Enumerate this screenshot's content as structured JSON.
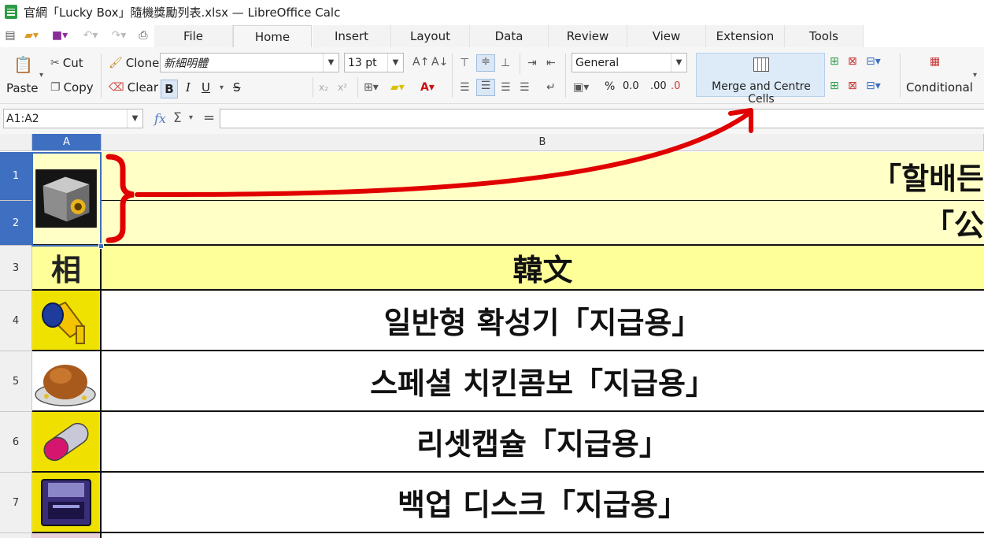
{
  "window": {
    "title": "官網「Lucky Box」隨機獎勵列表.xlsx — LibreOffice Calc"
  },
  "menu": {
    "tabs": [
      "File",
      "Home",
      "Insert",
      "Layout",
      "Data",
      "Review",
      "View",
      "Extension",
      "Tools"
    ],
    "active_tab": "Home"
  },
  "ribbon": {
    "paste": "Paste",
    "cut": "Cut",
    "copy": "Copy",
    "clone": "Clone",
    "clear": "Clear",
    "font_name": "新細明體",
    "font_size": "13 pt",
    "bold": "B",
    "italic": "I",
    "underline": "U",
    "strike": "S",
    "number_format": "General",
    "merge_label": "Merge and Centre Cells",
    "conditional": "Conditional",
    "percent": "%",
    "decimal": "0.0",
    "add_decimal": ".00",
    "remove_decimal": ".0"
  },
  "formula_bar": {
    "cell_ref": "A1:A2",
    "fx": "fx",
    "sigma": "Σ",
    "equals": "=",
    "content": ""
  },
  "grid": {
    "columns": [
      "A",
      "B"
    ],
    "rows": [
      {
        "num": "1",
        "a_text": "",
        "a_icon": "gray-box-icon",
        "b_text": "「할배든"
      },
      {
        "num": "2",
        "a_text": "",
        "a_icon": "",
        "b_text": "「公"
      },
      {
        "num": "3",
        "a_text": "相",
        "a_icon": "",
        "b_text": "韓文"
      },
      {
        "num": "4",
        "a_text": "",
        "a_icon": "megaphone-icon",
        "b_text": "일반형 확성기「지급용」"
      },
      {
        "num": "5",
        "a_text": "",
        "a_icon": "roast-chicken-icon",
        "b_text": "스페셜 치킨콤보「지급용」"
      },
      {
        "num": "6",
        "a_text": "",
        "a_icon": "capsule-icon",
        "b_text": "리셋캡슐「지급용」"
      },
      {
        "num": "7",
        "a_text": "",
        "a_icon": "floppy-disk-icon",
        "b_text": "백업 디스크「지급용」"
      }
    ],
    "selected_range": "A1:A2"
  },
  "colors": {
    "selection": "#3e6fc0",
    "merged_header_bg": "#ffffc6",
    "row3_bg": "#ffff99",
    "annotation": "#e00000",
    "merge_button_bg": "#ddebf8"
  }
}
